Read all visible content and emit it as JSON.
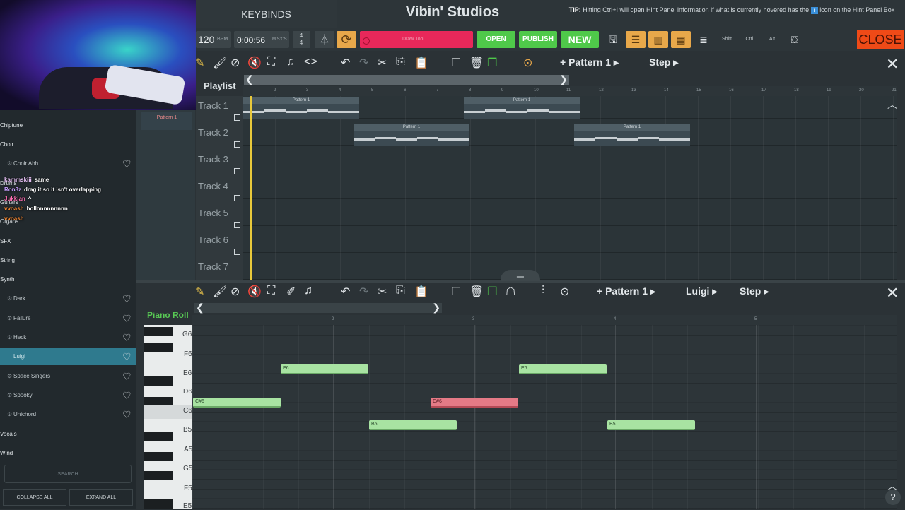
{
  "header": {
    "keybinds_label": "KEYBINDS",
    "title": "Vibin' Studios",
    "tip_prefix": "TIP:",
    "tip_text": "Hitting Ctrl+I will open Hint Panel information if what is currently hovered has the",
    "tip_icon": "i",
    "tip_suffix": "icon on the Hint Panel Box"
  },
  "transport": {
    "bpm_value": "120",
    "bpm_unit": "BPM",
    "time_value": "0:00:56",
    "time_unit": "M:S:CS",
    "timesig_top": "4",
    "timesig_bottom": "4",
    "record_label": "Draw Tool",
    "open_label": "OPEN",
    "publish_label": "PUBLISH",
    "new_label": "NEW",
    "shift_label": "Shift",
    "ctrl_label": "Ctrl",
    "alt_label": "Alt",
    "close_label": "CLOSE"
  },
  "sidebar": {
    "categories": {
      "chiptune": "Chiptune",
      "choir": "Choir",
      "drums": "Drums",
      "guitars": "Guitars",
      "organs": "Organs",
      "sfx": "SFX",
      "string": "String",
      "synth": "Synth",
      "vocals": "Vocals",
      "wind": "Wind"
    },
    "instruments": {
      "choir_ahh": "Choir Ahh",
      "dark": "Dark",
      "failure": "Failure",
      "heck": "Heck",
      "luigi": "Luigi",
      "space_singers": "Space Singers",
      "spooky": "Spooky",
      "unichord": "Unichord"
    },
    "search_label": "SEARCH",
    "collapse_label": "COLLAPSE ALL",
    "expand_label": "EXPAND ALL"
  },
  "chat": [
    {
      "user": "kammskiii",
      "msg": "same",
      "color": "#f0c8ff"
    },
    {
      "user": "Ron8z",
      "msg": "drag it so it isn't overlapping",
      "color": "#c8a0ff"
    },
    {
      "user": "Jukkian",
      "msg": "^",
      "color": "#ff6fb4"
    },
    {
      "user": "vvoash",
      "msg": "hollonnnnnnnn",
      "color": "#ff8c32"
    },
    {
      "user": "vvoash",
      "msg": "",
      "color": "#ff8c32"
    }
  ],
  "pattern_list": {
    "item": "Pattern 1"
  },
  "playlist": {
    "label": "Playlist",
    "pattern_name": "Pattern 1",
    "step_label": "Step",
    "tracks": [
      "Track 1",
      "Track 2",
      "Track 3",
      "Track 4",
      "Track 5",
      "Track 6",
      "Track 7"
    ],
    "clip_label": "Pattern 1",
    "ruler": [
      "2",
      "3",
      "4",
      "5",
      "6",
      "7",
      "8",
      "9",
      "10",
      "11",
      "12",
      "13",
      "14",
      "15",
      "16",
      "17",
      "18",
      "19",
      "20",
      "21"
    ]
  },
  "piano_roll": {
    "label": "Piano Roll",
    "pattern_name": "Pattern 1",
    "instrument_name": "Luigi",
    "step_label": "Step",
    "ruler": [
      "2",
      "3",
      "4",
      "5"
    ],
    "keys": [
      "G6",
      "F6",
      "E6",
      "D6",
      "C6",
      "B5",
      "A5",
      "G5",
      "F5",
      "E5"
    ],
    "notes": [
      "E6",
      "E6",
      "C#6",
      "C#6",
      "B5",
      "B5"
    ]
  },
  "colors": {
    "accent_green": "#4fc94a",
    "record_pink": "#e8285a",
    "close_orange": "#ef4a17",
    "selected_teal": "#2f7a8e",
    "note_green": "#a8e3a2",
    "note_red": "#e47a86"
  }
}
